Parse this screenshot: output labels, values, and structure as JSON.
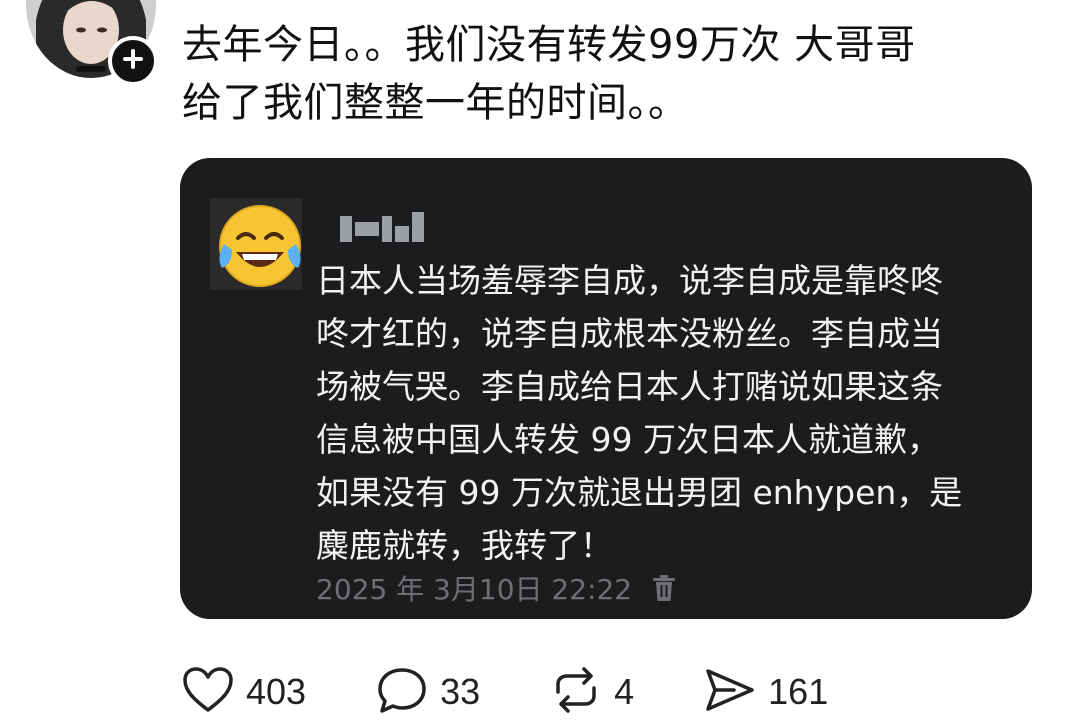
{
  "post": {
    "text_lines": [
      "去年今日。。我们没有转发99万次 大哥哥",
      "给了我们整整一年的时间。。"
    ]
  },
  "quote": {
    "text_lines": [
      "日本人当场羞辱李自成，说李自成是靠咚咚",
      "咚才红的，说李自成根本没粉丝。李自成当",
      "场被气哭。李自成给日本人打赌说如果这条",
      "信息被中国人转发 99 万次日本人就道歉，",
      "如果没有 99 万次就退出男团 enhypen，是",
      "麋鹿就转，我转了！"
    ],
    "timestamp": "2025 年 3月10日 22:22",
    "background_color": "#1c1c1e"
  },
  "actions": {
    "likes": "403",
    "replies": "33",
    "reposts": "4",
    "shares": "161"
  },
  "icons": {
    "follow": "plus-icon",
    "quote_avatar": "laughing-crying-emoji-icon",
    "delete": "trash-icon",
    "like": "heart-icon",
    "reply": "comment-bubble-icon",
    "repost": "repost-icon",
    "share": "send-icon"
  }
}
